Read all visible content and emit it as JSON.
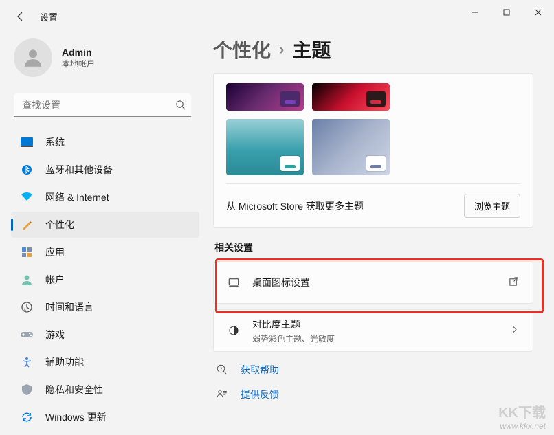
{
  "app_title": "设置",
  "window_controls": {
    "minimize": "—",
    "maximize": "□",
    "close": "✕"
  },
  "user": {
    "name": "Admin",
    "type": "本地帐户"
  },
  "search": {
    "placeholder": "查找设置"
  },
  "nav": {
    "items": [
      {
        "label": "系统",
        "icon": "system"
      },
      {
        "label": "蓝牙和其他设备",
        "icon": "bluetooth"
      },
      {
        "label": "网络 & Internet",
        "icon": "network"
      },
      {
        "label": "个性化",
        "icon": "personalize",
        "active": true
      },
      {
        "label": "应用",
        "icon": "apps"
      },
      {
        "label": "帐户",
        "icon": "accounts"
      },
      {
        "label": "时间和语言",
        "icon": "time"
      },
      {
        "label": "游戏",
        "icon": "gaming"
      },
      {
        "label": "辅助功能",
        "icon": "accessibility"
      },
      {
        "label": "隐私和安全性",
        "icon": "privacy"
      },
      {
        "label": "Windows 更新",
        "icon": "update"
      }
    ]
  },
  "breadcrumb": {
    "parent": "个性化",
    "sep": "›",
    "current": "主题"
  },
  "themes": {
    "store_text": "从 Microsoft Store 获取更多主题",
    "browse_label": "浏览主题",
    "thumbs": [
      {
        "bg": "linear-gradient(135deg,#1a0033,#6a2c70,#b83b8e)",
        "chip": "#7a3fbf",
        "chip_bg": "#4a2a6a"
      },
      {
        "bg": "linear-gradient(135deg,#000,#c8102e,#ff4b5c)",
        "chip": "#d7263d",
        "chip_bg": "#2a1a1a"
      },
      {
        "bg": "linear-gradient(180deg,#9ad0d6,#3aa0ad 55%,#2a8a95)",
        "chip": "#2aa5a0",
        "chip_bg": "#fff"
      },
      {
        "bg": "linear-gradient(135deg,#6a7fa8,#a8b4cc,#cfd6e6)",
        "chip": "#6f7ea6",
        "chip_bg": "#fff"
      }
    ]
  },
  "related": {
    "title": "相关设置",
    "items": [
      {
        "title": "桌面图标设置",
        "icon": "desktop",
        "action": "external"
      },
      {
        "title": "对比度主题",
        "sub": "弱势彩色主题、光敏度",
        "icon": "contrast",
        "action": "chevron"
      }
    ]
  },
  "help_links": {
    "help": "获取帮助",
    "feedback": "提供反馈"
  },
  "watermark": {
    "brand": "KK下载",
    "url": "www.kkx.net"
  }
}
